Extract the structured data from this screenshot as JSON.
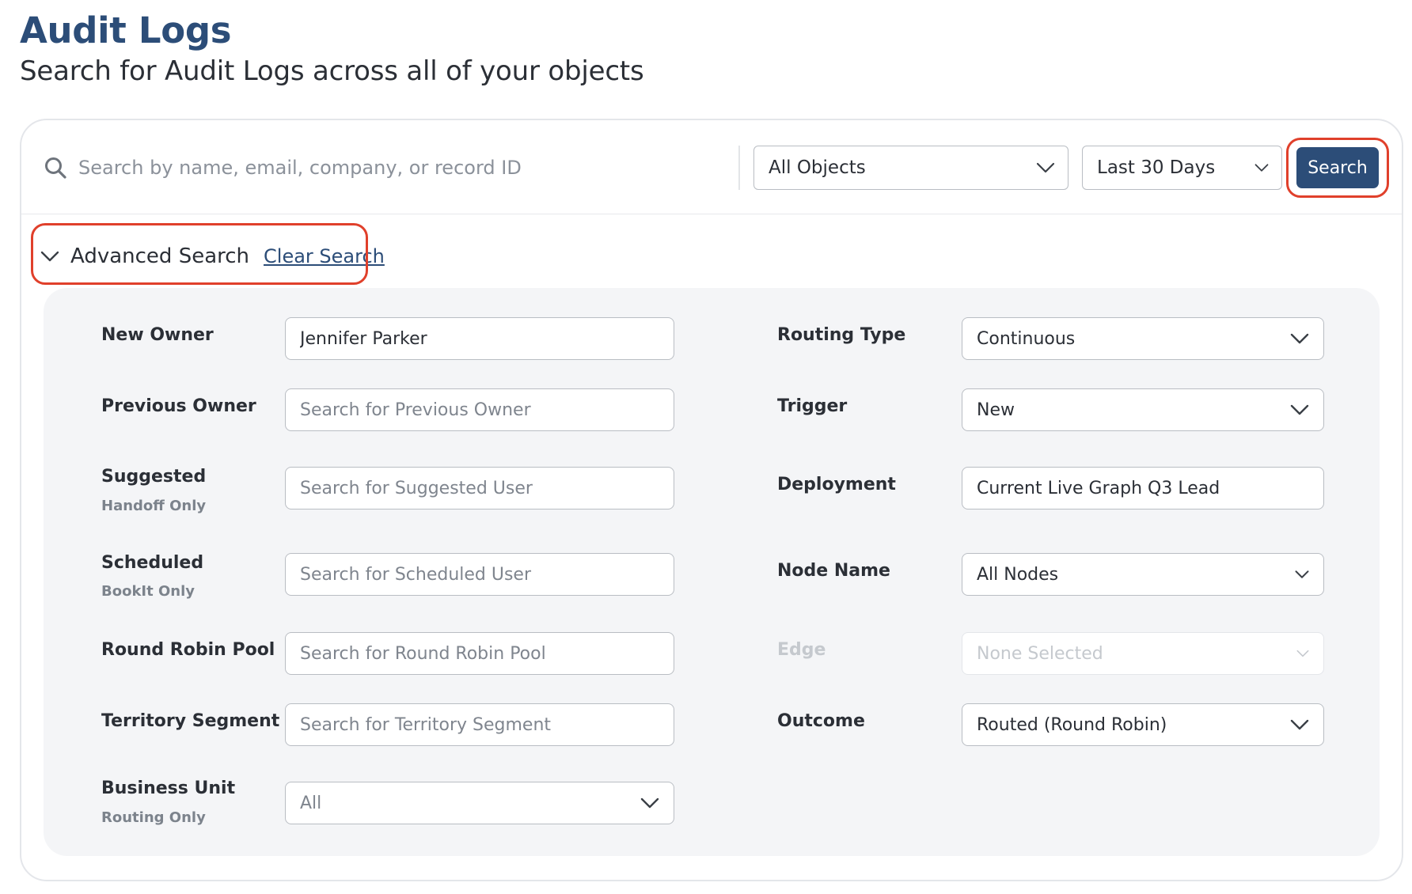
{
  "header": {
    "title": "Audit Logs",
    "subtitle": "Search for Audit Logs across all of your objects"
  },
  "toolbar": {
    "search_placeholder": "Search by name, email, company, or record ID",
    "objects_select": "All Objects",
    "range_select": "Last 30 Days",
    "search_button": "Search"
  },
  "advanced": {
    "label": "Advanced Search",
    "clear_link": "Clear Search"
  },
  "fields": {
    "new_owner": {
      "label": "New Owner",
      "value": "Jennifer Parker"
    },
    "previous_owner": {
      "label": "Previous Owner",
      "placeholder": "Search for Previous Owner"
    },
    "suggested": {
      "label": "Suggested",
      "sub": "Handoff Only",
      "placeholder": "Search for Suggested User"
    },
    "scheduled": {
      "label": "Scheduled",
      "sub": "BookIt Only",
      "placeholder": "Search for Scheduled User"
    },
    "round_robin_pool": {
      "label": "Round Robin Pool",
      "placeholder": "Search for Round Robin Pool"
    },
    "territory_segment": {
      "label": "Territory Segment",
      "placeholder": "Search for Territory Segment"
    },
    "business_unit": {
      "label": "Business Unit",
      "sub": "Routing Only",
      "value": "All"
    },
    "routing_type": {
      "label": "Routing Type",
      "value": "Continuous"
    },
    "trigger": {
      "label": "Trigger",
      "value": "New"
    },
    "deployment": {
      "label": "Deployment",
      "value": "Current Live Graph Q3 Lead"
    },
    "node_name": {
      "label": "Node Name",
      "value": "All Nodes"
    },
    "edge": {
      "label": "Edge",
      "value": "None Selected"
    },
    "outcome": {
      "label": "Outcome",
      "value": "Routed (Round Robin)"
    }
  },
  "colors": {
    "brand": "#2c4d78",
    "highlight": "#e0402b",
    "panel_bg": "#f4f5f7"
  }
}
